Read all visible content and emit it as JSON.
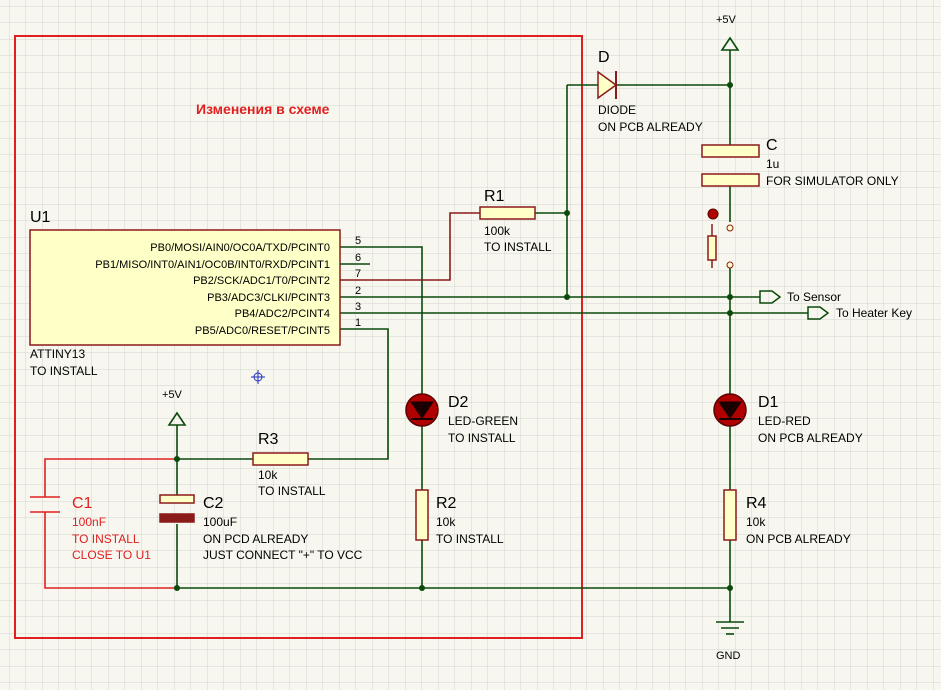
{
  "colors": {
    "background": "#f7f7f0",
    "grid": "#d6d6d0",
    "wire": "#0a4a0a",
    "component": "#8b1a1a",
    "component_fill": "#ffffc8",
    "led_fill": "#b00000",
    "text": "#000000",
    "annotation": "#e02020",
    "power": "#0a4a0a",
    "selection_box": "#e02020"
  },
  "annotation": {
    "title": "Изменения в схеме"
  },
  "u1": {
    "ref": "U1",
    "part": "ATTINY13",
    "note": "TO INSTALL",
    "pins": [
      {
        "label": "PB0/MOSI/AIN0/OC0A/TXD/PCINT0",
        "num": "5"
      },
      {
        "label": "PB1/MISO/INT0/AIN1/OC0B/INT0/RXD/PCINT1",
        "num": "6"
      },
      {
        "label": "PB2/SCK/ADC1/T0/PCINT2",
        "num": "7"
      },
      {
        "label": "PB3/ADC3/CLKI/PCINT3",
        "num": "2"
      },
      {
        "label": "PB4/ADC2/PCINT4",
        "num": "3"
      },
      {
        "label": "PB5/ADC0/RESET/PCINT5",
        "num": "1"
      }
    ]
  },
  "r1": {
    "ref": "R1",
    "value": "100k",
    "note": "TO INSTALL"
  },
  "r2": {
    "ref": "R2",
    "value": "10k",
    "note": "TO INSTALL"
  },
  "r3": {
    "ref": "R3",
    "value": "10k",
    "note": "TO INSTALL"
  },
  "r4": {
    "ref": "R4",
    "value": "10k",
    "note": "ON PCB ALREADY"
  },
  "c1": {
    "ref": "C1",
    "value": "100nF",
    "note1": "TO INSTALL",
    "note2": "CLOSE TO U1"
  },
  "c2": {
    "ref": "C2",
    "value": "100uF",
    "note1": "ON PCD ALREADY",
    "note2": "JUST CONNECT \"+\" TO VCC"
  },
  "c": {
    "ref": "C",
    "value": "1u",
    "note": "FOR SIMULATOR ONLY"
  },
  "d": {
    "ref": "D",
    "type": "DIODE",
    "note": "ON PCB ALREADY"
  },
  "d1": {
    "ref": "D1",
    "type": "LED-RED",
    "note": "ON PCB ALREADY"
  },
  "d2": {
    "ref": "D2",
    "type": "LED-GREEN",
    "note": "TO INSTALL"
  },
  "power": {
    "vcc_top": "+5V",
    "vcc_left": "+5V",
    "gnd": "GND"
  },
  "ports": {
    "sensor": "To Sensor",
    "heater": "To Heater Key"
  }
}
